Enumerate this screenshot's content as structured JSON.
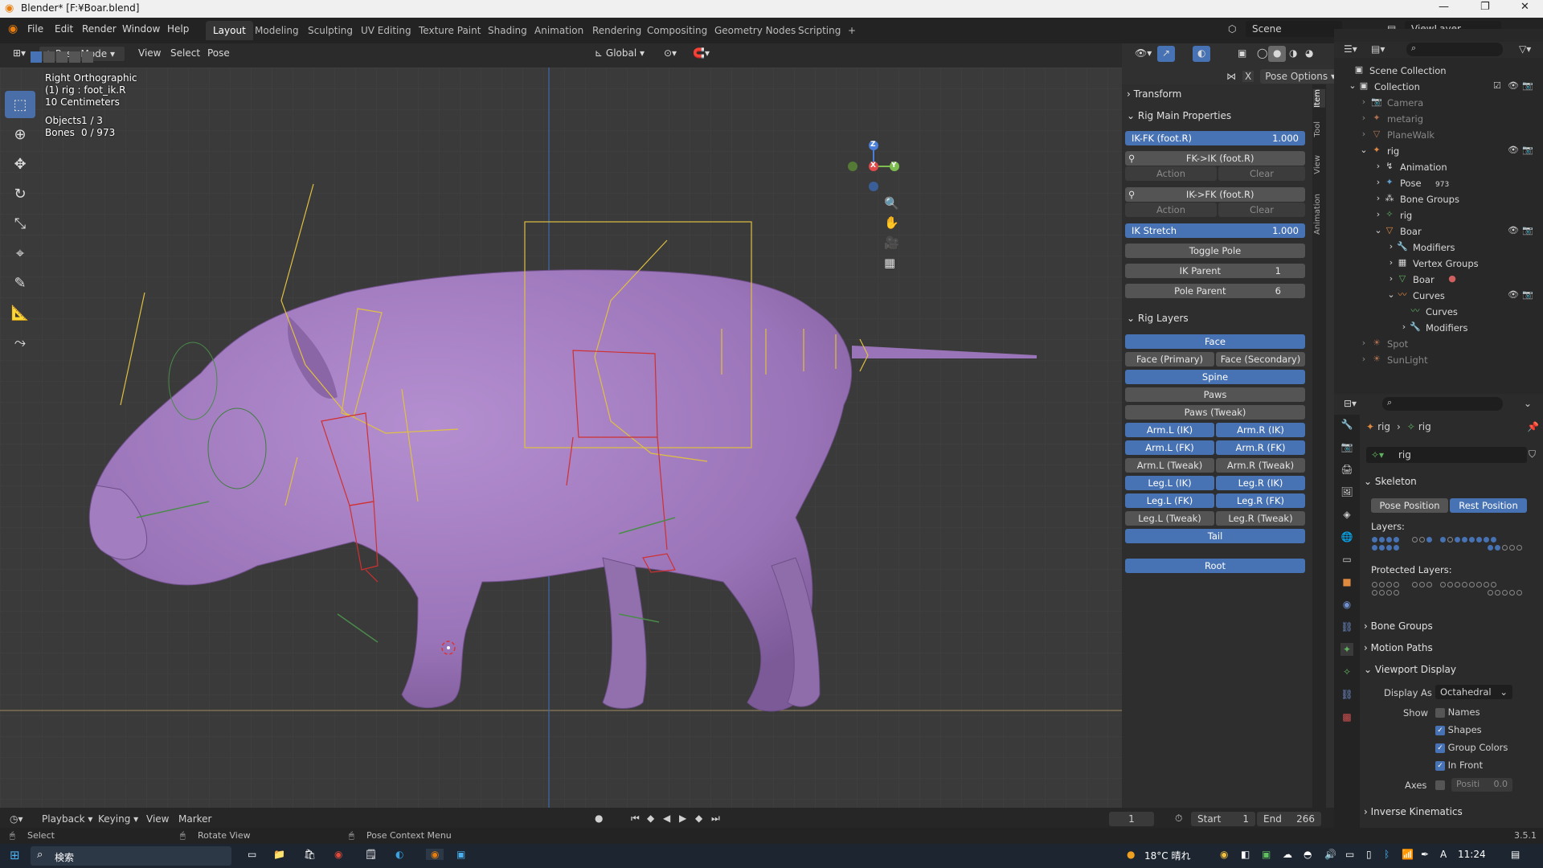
{
  "window": {
    "title": "Blender* [F:¥Boar.blend]"
  },
  "menus": [
    "File",
    "Edit",
    "Render",
    "Window",
    "Help"
  ],
  "workspaces": [
    "Layout",
    "Modeling",
    "Sculpting",
    "UV Editing",
    "Texture Paint",
    "Shading",
    "Animation",
    "Rendering",
    "Compositing",
    "Geometry Nodes",
    "Scripting",
    "+"
  ],
  "scene": {
    "label": "Scene",
    "viewlayer": "ViewLayer"
  },
  "viewport_header": {
    "mode": "Pose Mode",
    "menus": [
      "View",
      "Select",
      "Pose"
    ],
    "orientation": "Global",
    "pose_options": "Pose Options"
  },
  "overlay": {
    "view_name": "Right Orthographic",
    "active": "(1) rig : foot_ik.R",
    "scale": "10 Centimeters",
    "objects_label": "Objects",
    "objects_value": "1 / 3",
    "bones_label": "Bones",
    "bones_value": "0 / 973"
  },
  "gizmo": {
    "z": "Z",
    "x": "X",
    "y": "Y"
  },
  "npanel": {
    "transform": "Transform",
    "rig_main": "Rig Main Properties",
    "ikfk_label": "IK-FK (foot.R)",
    "ikfk_value": "1.000",
    "fk_to_ik": "FK->IK (foot.R)",
    "action": "Action",
    "clear": "Clear",
    "ik_to_fk": "IK->FK (foot.R)",
    "ik_stretch_label": "IK Stretch",
    "ik_stretch_value": "1.000",
    "toggle_pole": "Toggle Pole",
    "ik_parent_label": "IK Parent",
    "ik_parent_value": "1",
    "pole_parent_label": "Pole Parent",
    "pole_parent_value": "6",
    "rig_layers": "Rig Layers",
    "layers": {
      "face": "Face",
      "face_primary": "Face (Primary)",
      "face_secondary": "Face (Secondary)",
      "spine": "Spine",
      "paws": "Paws",
      "paws_tweak": "Paws (Tweak)",
      "arm_l_ik": "Arm.L (IK)",
      "arm_r_ik": "Arm.R (IK)",
      "arm_l_fk": "Arm.L (FK)",
      "arm_r_fk": "Arm.R (FK)",
      "arm_l_tweak": "Arm.L (Tweak)",
      "arm_r_tweak": "Arm.R (Tweak)",
      "leg_l_ik": "Leg.L (IK)",
      "leg_r_ik": "Leg.R (IK)",
      "leg_l_fk": "Leg.L (FK)",
      "leg_r_fk": "Leg.R (FK)",
      "leg_l_tweak": "Leg.L (Tweak)",
      "leg_r_tweak": "Leg.R (Tweak)",
      "tail": "Tail",
      "root": "Root"
    },
    "tabs": [
      "Item",
      "Tool",
      "View",
      "Animation"
    ]
  },
  "outliner": {
    "scene_collection": "Scene Collection",
    "collection": "Collection",
    "items": {
      "camera": "Camera",
      "metarig": "metarig",
      "planewalk": "PlaneWalk",
      "rig": "rig",
      "animation": "Animation",
      "pose": "Pose",
      "pose_count": "973",
      "bone_groups": "Bone Groups",
      "rig_data": "rig",
      "boar": "Boar",
      "modifiers": "Modifiers",
      "vertex_groups": "Vertex Groups",
      "boar_mat": "Boar",
      "curves": "Curves",
      "curves_data": "Curves",
      "curves_mod": "Modifiers",
      "spot": "Spot",
      "sunlight": "SunLight"
    }
  },
  "properties": {
    "breadcrumb_a": "rig",
    "breadcrumb_b": "rig",
    "name_field": "rig",
    "skeleton": "Skeleton",
    "pose_position": "Pose Position",
    "rest_position": "Rest Position",
    "layers": "Layers:",
    "protected_layers": "Protected Layers:",
    "bone_groups": "Bone Groups",
    "motion_paths": "Motion Paths",
    "viewport_display": "Viewport Display",
    "display_as_label": "Display As",
    "display_as_value": "Octahedral",
    "show_label": "Show",
    "names": "Names",
    "shapes": "Shapes",
    "group_colors": "Group Colors",
    "in_front": "In Front",
    "axes": "Axes",
    "axes_pos_label": "Positi",
    "axes_pos_value": "0.0",
    "inverse_kinematics": "Inverse Kinematics"
  },
  "timeline": {
    "menus": [
      "Playback",
      "Keying",
      "View",
      "Marker"
    ],
    "current_frame": "1",
    "start_label": "Start",
    "start_value": "1",
    "end_label": "End",
    "end_value": "266"
  },
  "status": {
    "select": "Select",
    "rotate_view": "Rotate View",
    "context_menu": "Pose Context Menu",
    "version": "3.5.1"
  },
  "taskbar": {
    "search": "検索",
    "weather": "18°C 晴れ",
    "ime": "A",
    "time": "11:24"
  },
  "colors": {
    "accent": "#4772b3",
    "pig": "#a680c2",
    "bone_yellow": "#e0c040",
    "bone_red": "#d03030"
  }
}
